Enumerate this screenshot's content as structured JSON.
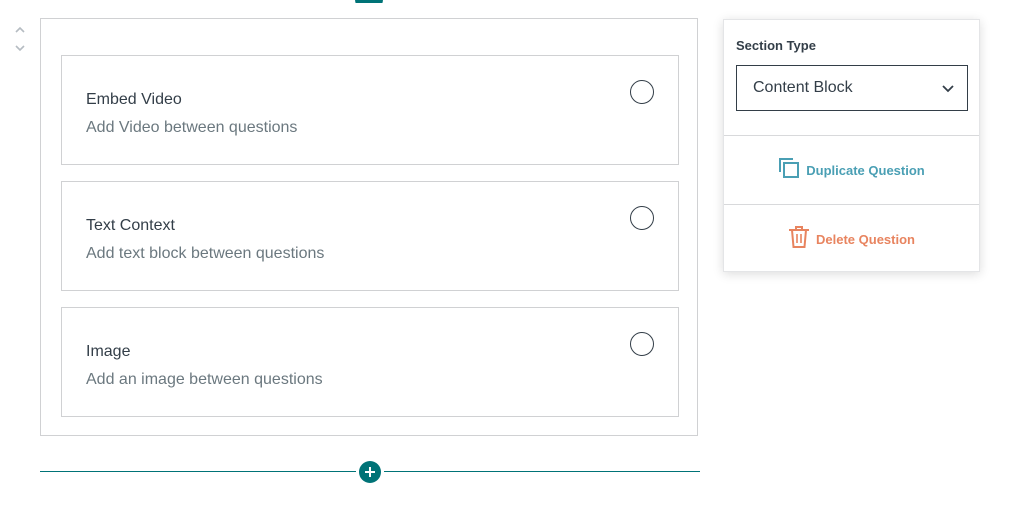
{
  "options": [
    {
      "title": "Embed Video",
      "description": "Add Video between questions"
    },
    {
      "title": "Text Context",
      "description": "Add text block between questions"
    },
    {
      "title": "Image",
      "description": "Add an image between questions"
    }
  ],
  "panel": {
    "section_type_label": "Section Type",
    "section_type_value": "Content Block",
    "duplicate_label": "Duplicate Question",
    "delete_label": "Delete Question"
  },
  "icons": {
    "reorder_up": "chevron-up-icon",
    "reorder_down": "chevron-down-icon",
    "add": "plus-circle-icon",
    "duplicate": "copy-icon",
    "delete": "trash-icon",
    "dropdown": "chevron-down-icon"
  },
  "colors": {
    "accent": "#007377",
    "duplicate": "#4a9fb4",
    "delete": "#e8845f",
    "text": "#333e48",
    "muted": "#6b787f"
  }
}
